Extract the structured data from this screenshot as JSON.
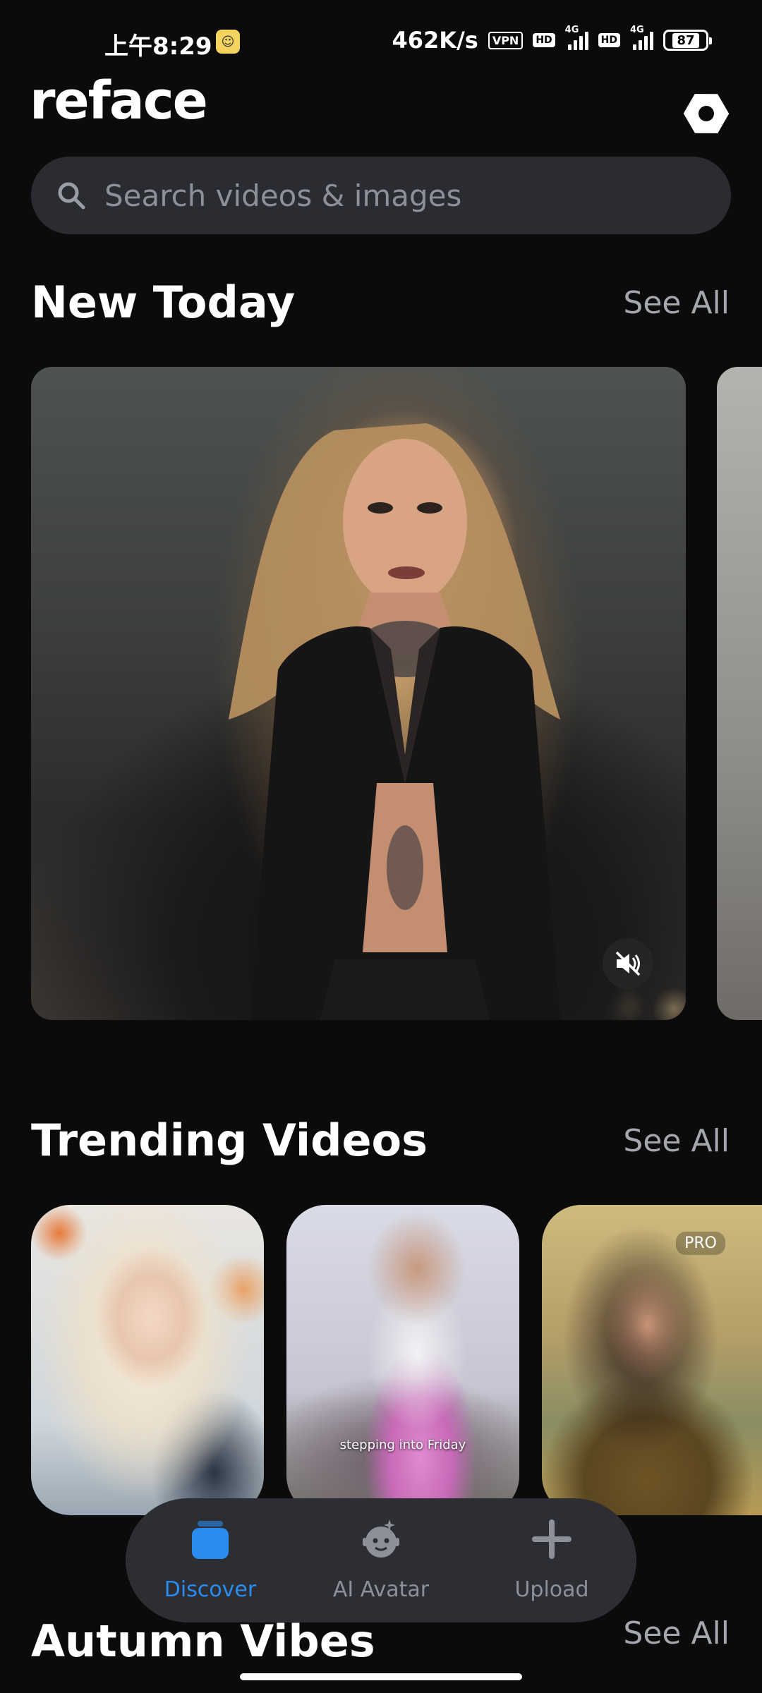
{
  "status_bar": {
    "time": "上午8:29",
    "net_speed": "462K/s",
    "vpn": "VPN",
    "hd1": "HD",
    "hd2": "HD",
    "net1": "4G",
    "net2": "4G",
    "battery": "87"
  },
  "header": {
    "brand": "reface",
    "settings_icon": "hexagon-settings-icon"
  },
  "search": {
    "placeholder": "Search videos & images",
    "icon": "search-icon"
  },
  "sections": {
    "new_today": {
      "title": "New Today",
      "see_all": "See All",
      "sound_icon": "speaker-muted-icon"
    },
    "trending": {
      "title": "Trending Videos",
      "see_all": "See All",
      "cards": [
        {
          "caption": ""
        },
        {
          "caption": "stepping into Friday"
        },
        {
          "badge": "PRO"
        }
      ]
    },
    "autumn": {
      "title": "Autumn Vibes",
      "see_all": "See All"
    }
  },
  "bottom_nav": {
    "items": [
      {
        "label": "Discover",
        "icon": "stack-icon",
        "active": true
      },
      {
        "label": "AI Avatar",
        "icon": "robot-avatar-icon",
        "active": false
      },
      {
        "label": "Upload",
        "icon": "plus-icon",
        "active": false
      }
    ]
  },
  "colors": {
    "background": "#0b0b0c",
    "accent": "#2b8cf0",
    "muted_text": "#a4a7ad",
    "surface": "#2c2e33"
  }
}
